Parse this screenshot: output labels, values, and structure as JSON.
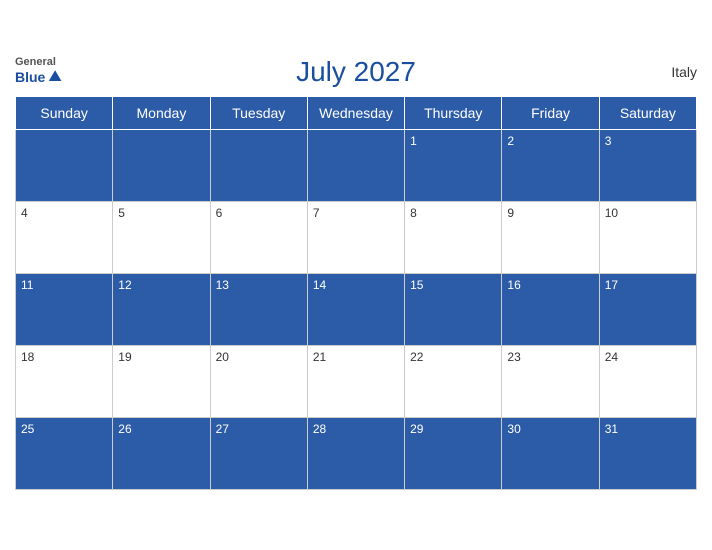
{
  "header": {
    "title": "July 2027",
    "country": "Italy",
    "logo": {
      "general": "General",
      "blue": "Blue"
    }
  },
  "weekdays": [
    "Sunday",
    "Monday",
    "Tuesday",
    "Wednesday",
    "Thursday",
    "Friday",
    "Saturday"
  ],
  "weeks": [
    [
      null,
      null,
      null,
      null,
      1,
      2,
      3
    ],
    [
      4,
      5,
      6,
      7,
      8,
      9,
      10
    ],
    [
      11,
      12,
      13,
      14,
      15,
      16,
      17
    ],
    [
      18,
      19,
      20,
      21,
      22,
      23,
      24
    ],
    [
      25,
      26,
      27,
      28,
      29,
      30,
      31
    ]
  ]
}
